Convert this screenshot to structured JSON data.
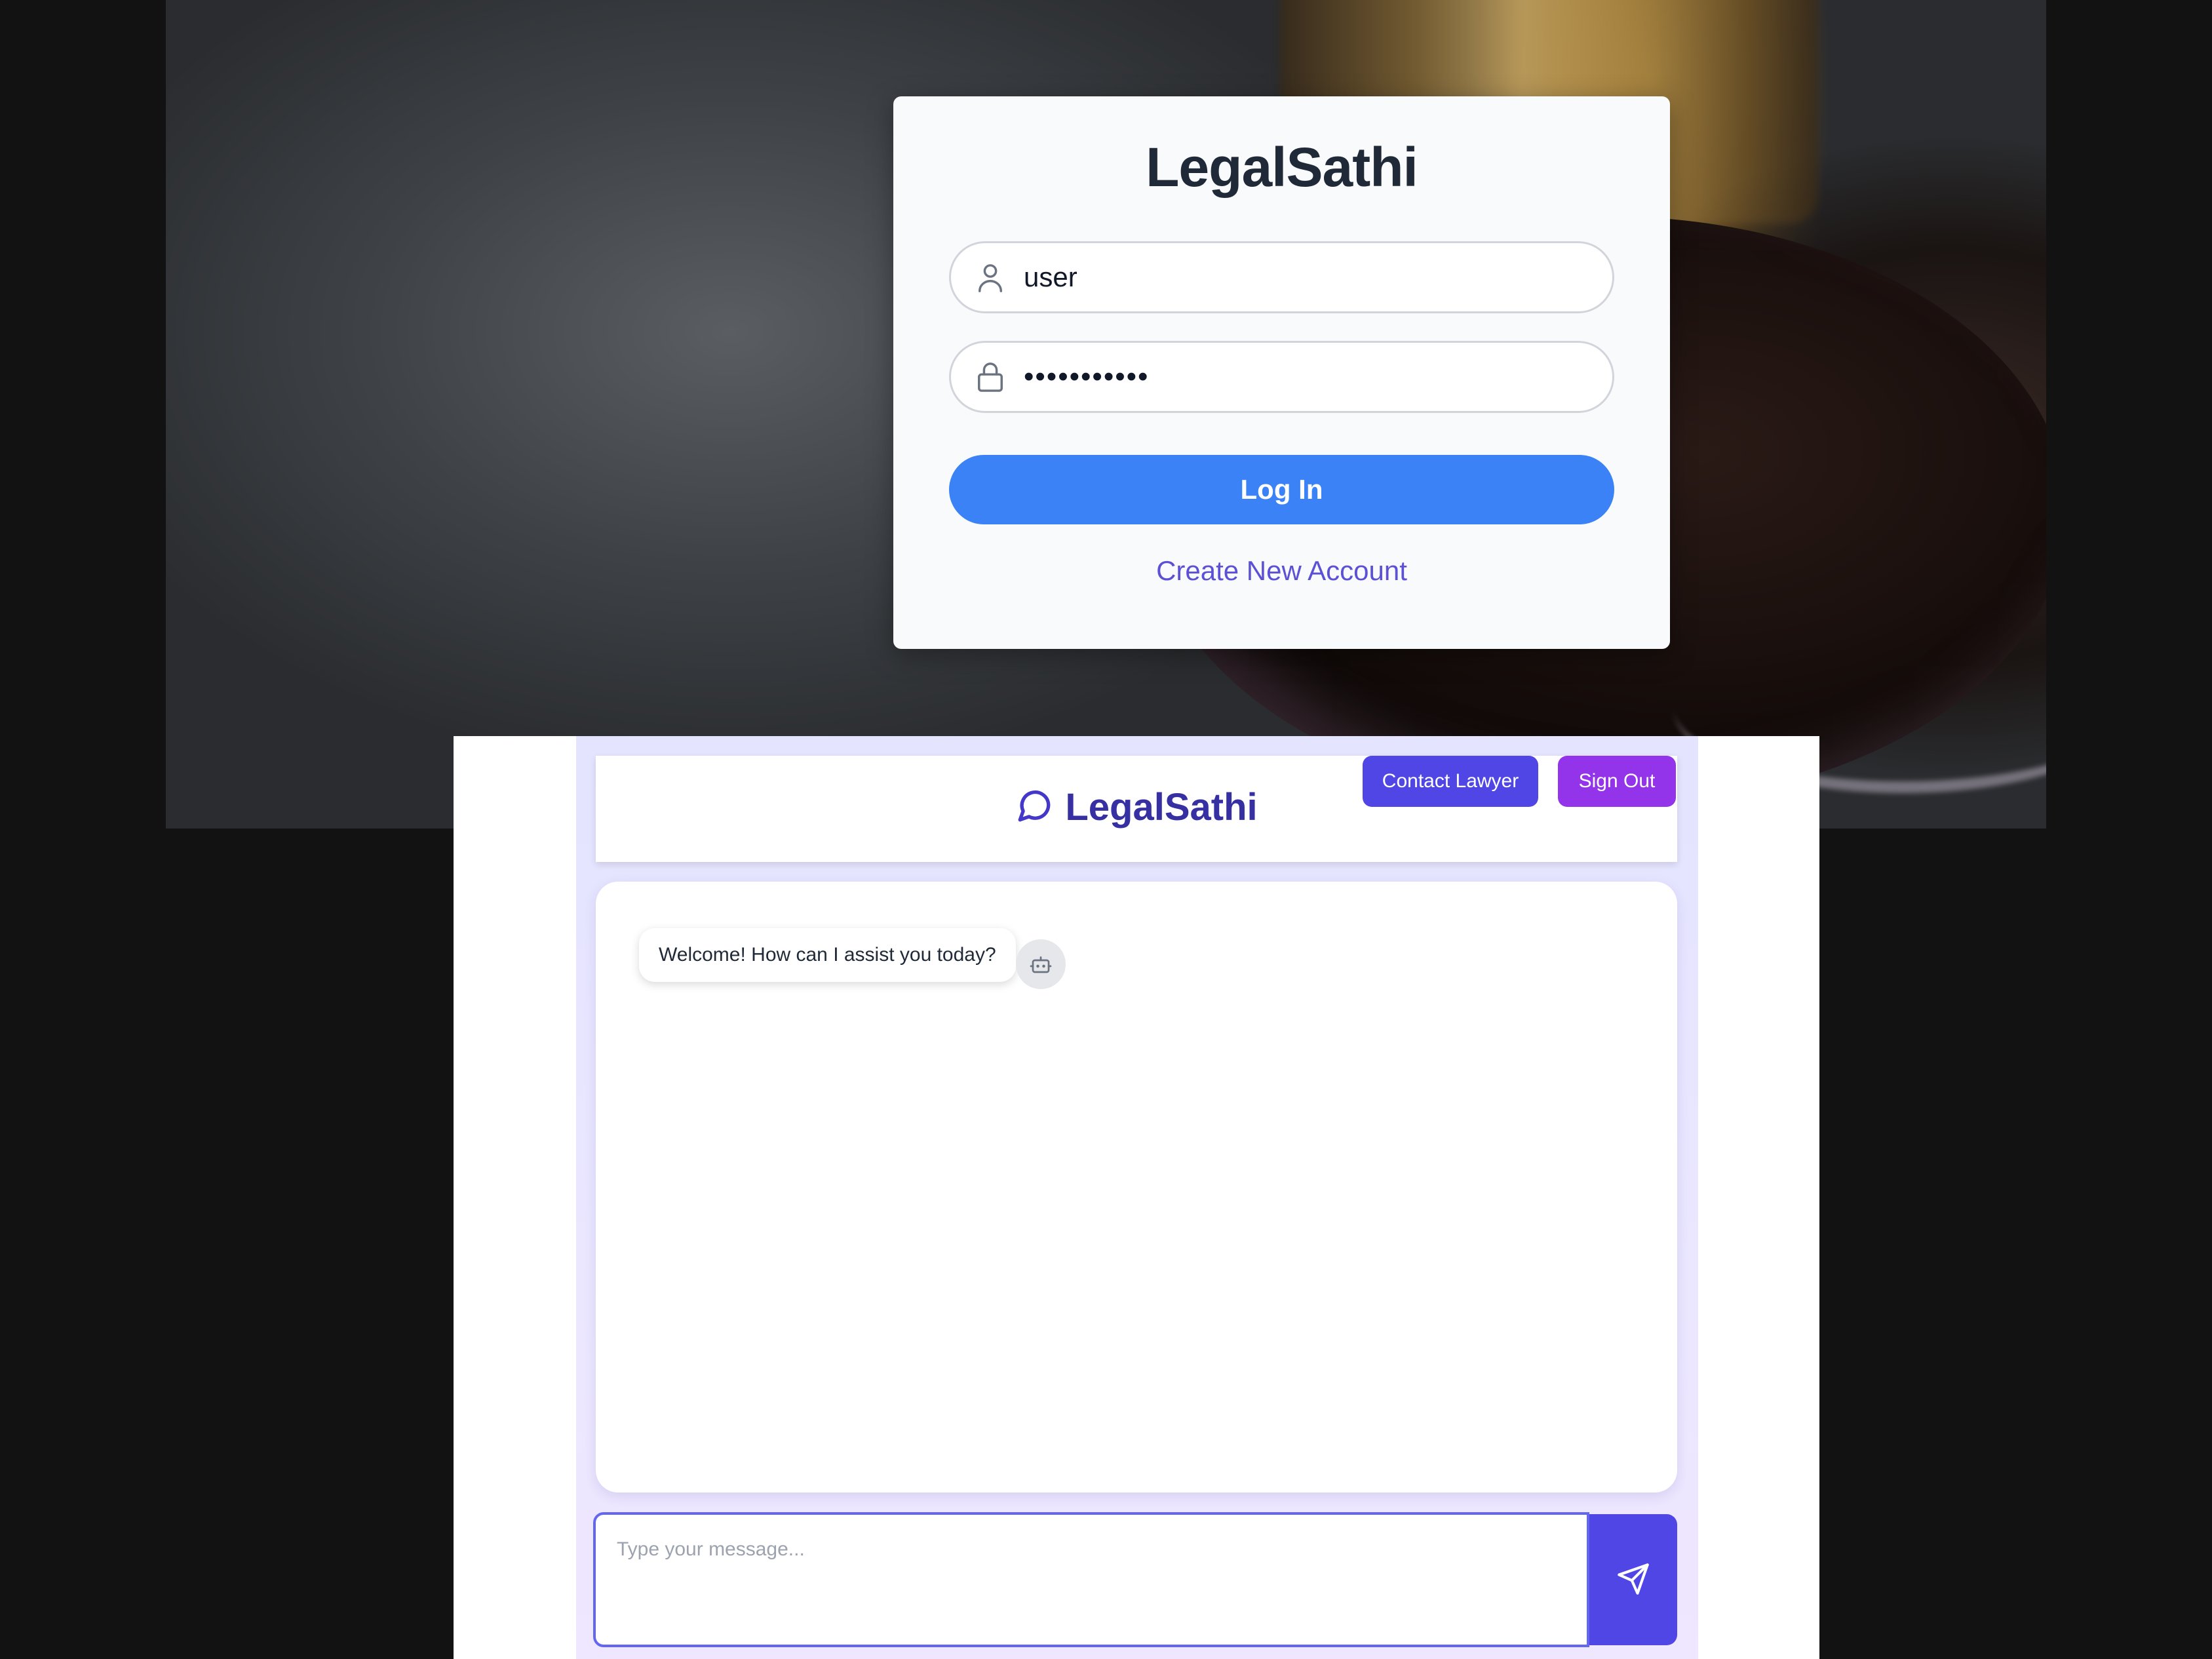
{
  "login": {
    "title": "LegalSathi",
    "username_value": "user",
    "password_value": "***********",
    "login_button": "Log In",
    "create_account_link": "Create New Account",
    "colors": {
      "primary_button": "#3b82f6",
      "link": "#5b50d6"
    }
  },
  "chat": {
    "brand_name": "LegalSathi",
    "contact_lawyer_button": "Contact Lawyer",
    "sign_out_button": "Sign Out",
    "messages": [
      {
        "sender": "bot",
        "text": "Welcome! How can I assist you today?"
      }
    ],
    "input_placeholder": "Type your message...",
    "icons": {
      "brand": "chat-bubble-icon",
      "bot": "robot-icon",
      "send": "send-icon"
    },
    "colors": {
      "brand_text": "#3730a3",
      "contact_button": "#4f46e5",
      "sign_out_button": "#9333ea",
      "send_button": "#4f46e5"
    }
  }
}
